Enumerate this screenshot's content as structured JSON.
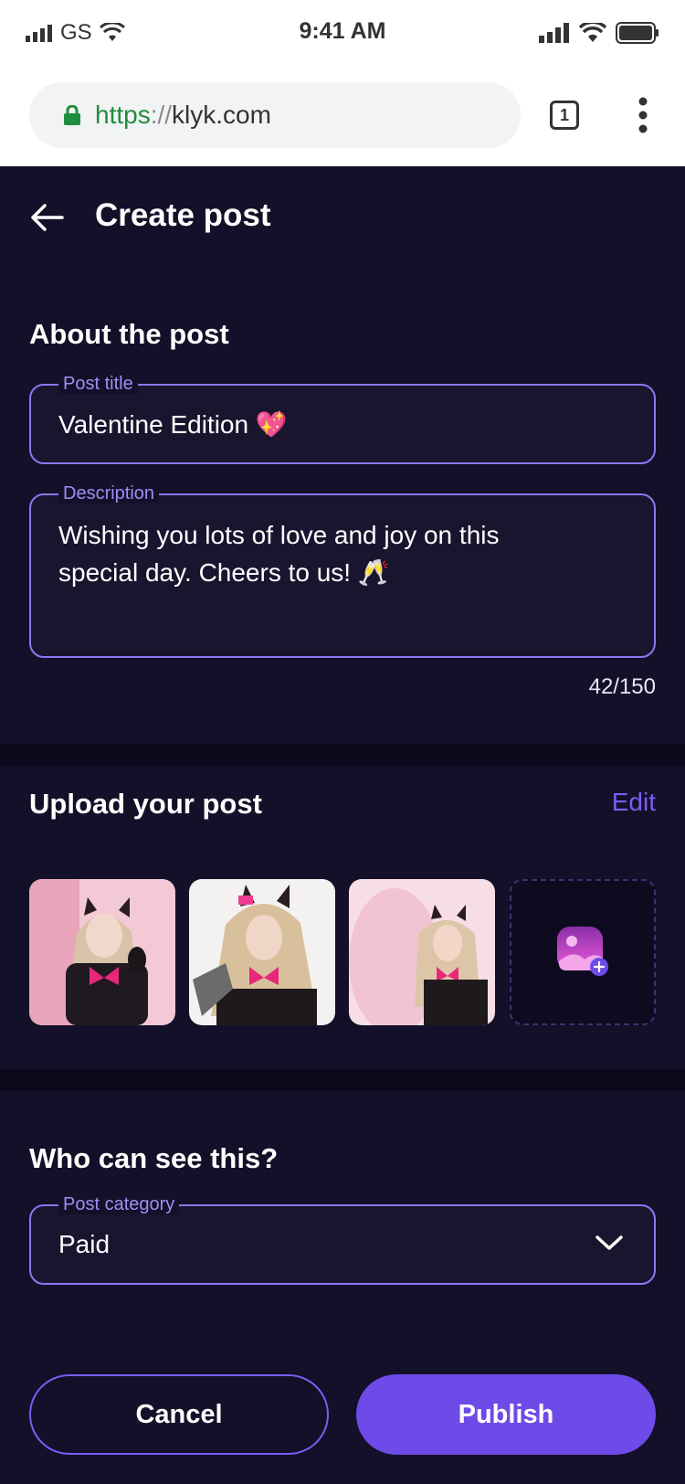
{
  "status_bar": {
    "carrier": "GS",
    "time": "9:41 AM",
    "icons": [
      "signal-icon",
      "wifi-icon",
      "battery-icon"
    ]
  },
  "browser": {
    "url_scheme": "https",
    "url_separator": "://",
    "url_host": "klyk.com",
    "tab_count": "1",
    "icons": [
      "lock-icon",
      "tabs-icon",
      "more-vertical-icon"
    ]
  },
  "header": {
    "title": "Create post",
    "back_icon": "arrow-left-icon"
  },
  "about": {
    "title": "About the post",
    "post_title_label": "Post title",
    "post_title_value": "Valentine Edition 💖",
    "description_label": "Description",
    "description_line1": "Wishing you lots of love and joy on this",
    "description_line2": "special day. Cheers to us! 🥂",
    "counter": "42/150"
  },
  "upload": {
    "title": "Upload your post",
    "edit_label": "Edit",
    "thumbnails": [
      "photo-1",
      "photo-2",
      "photo-3"
    ],
    "add_icon": "add-image-icon"
  },
  "visibility": {
    "title": "Who can see this?",
    "category_label": "Post category",
    "category_value": "Paid",
    "dropdown_icon": "chevron-down-icon"
  },
  "actions": {
    "cancel_label": "Cancel",
    "publish_label": "Publish"
  },
  "colors": {
    "background": "#141029",
    "accent": "#6e4ae8",
    "field_border": "#8a78f0",
    "label": "#9e8ef5",
    "url_green": "#1e8e3e"
  }
}
